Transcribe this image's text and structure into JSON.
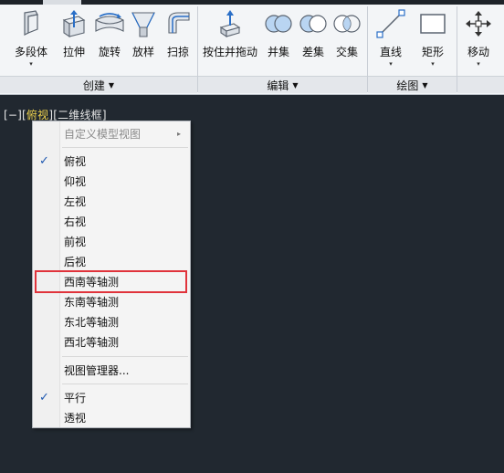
{
  "ribbon": {
    "tools": [
      {
        "id": "multibody",
        "label": "多段体",
        "has_dropdown": true,
        "icon": "polysolid-icon"
      },
      {
        "id": "extrude",
        "label": "拉伸",
        "has_dropdown": false,
        "icon": "extrude-icon"
      },
      {
        "id": "revolve",
        "label": "旋转",
        "has_dropdown": false,
        "icon": "revolve-icon"
      },
      {
        "id": "loft",
        "label": "放样",
        "has_dropdown": false,
        "icon": "loft-icon"
      },
      {
        "id": "sweep",
        "label": "扫掠",
        "has_dropdown": false,
        "icon": "sweep-icon"
      },
      {
        "id": "presspull",
        "label": "按住并拖动",
        "has_dropdown": false,
        "icon": "presspull-icon"
      },
      {
        "id": "union",
        "label": "并集",
        "has_dropdown": false,
        "icon": "union-icon"
      },
      {
        "id": "subtract",
        "label": "差集",
        "has_dropdown": false,
        "icon": "subtract-icon"
      },
      {
        "id": "intersect",
        "label": "交集",
        "has_dropdown": false,
        "icon": "intersect-icon"
      },
      {
        "id": "line",
        "label": "直线",
        "has_dropdown": true,
        "icon": "line-icon"
      },
      {
        "id": "rectangle",
        "label": "矩形",
        "has_dropdown": true,
        "icon": "rectangle-icon"
      },
      {
        "id": "move",
        "label": "移动",
        "has_dropdown": true,
        "icon": "move-icon"
      }
    ],
    "panels": {
      "create": "创建",
      "edit": "编辑",
      "draw": "绘图"
    }
  },
  "viewport": {
    "label_prefix": "[−][",
    "label_view": "俯视",
    "label_suffix": "][二维线框]"
  },
  "context_menu": {
    "custom_views": "自定义模型视图",
    "views": [
      {
        "label": "俯视",
        "checked": true
      },
      {
        "label": "仰视",
        "checked": false
      },
      {
        "label": "左视",
        "checked": false
      },
      {
        "label": "右视",
        "checked": false
      },
      {
        "label": "前视",
        "checked": false
      },
      {
        "label": "后视",
        "checked": false
      },
      {
        "label": "西南等轴测",
        "checked": false,
        "highlighted": true
      },
      {
        "label": "东南等轴测",
        "checked": false
      },
      {
        "label": "东北等轴测",
        "checked": false
      },
      {
        "label": "西北等轴测",
        "checked": false
      }
    ],
    "view_manager": "视图管理器...",
    "projection": [
      {
        "label": "平行",
        "checked": true
      },
      {
        "label": "透视",
        "checked": false
      }
    ],
    "check_glyph": "✓",
    "submenu_glyph": "▸"
  },
  "colors": {
    "viewport_bg": "#212830",
    "highlight_box": "#e0333b",
    "check": "#1e58b0",
    "active_view": "#f1d54e"
  }
}
